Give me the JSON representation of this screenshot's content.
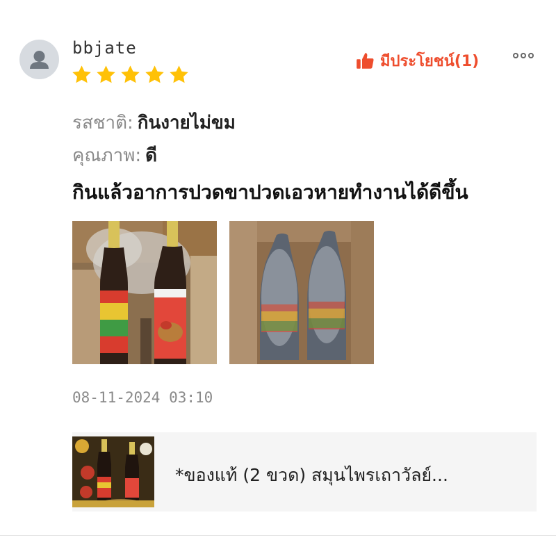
{
  "review": {
    "username": "bbjate",
    "rating": 5,
    "helpful_label": "มีประโยชน์(1)",
    "attributes": [
      {
        "label": "รสชาติ:",
        "value": "กินงายไม่ขม"
      },
      {
        "label": "คุณภาพ:",
        "value": "ดี"
      }
    ],
    "text": "กินแล้วอาการปวดขาปวดเอวหายทำงานได้ดีขึ้น",
    "timestamp": "08-11-2024 03:10"
  },
  "product": {
    "name": "*ของแท้ (2 ขวด) สมุนไพรเถาวัลย์..."
  },
  "colors": {
    "accent": "#ee4d2d",
    "star": "#ffc107",
    "muted_text": "#8a8a8a",
    "card_bg": "#f5f5f5"
  },
  "icons": {
    "avatar": "user-avatar-icon",
    "helpful": "thumbs-up-icon",
    "more": "more-options-icon",
    "star": "star-icon"
  }
}
